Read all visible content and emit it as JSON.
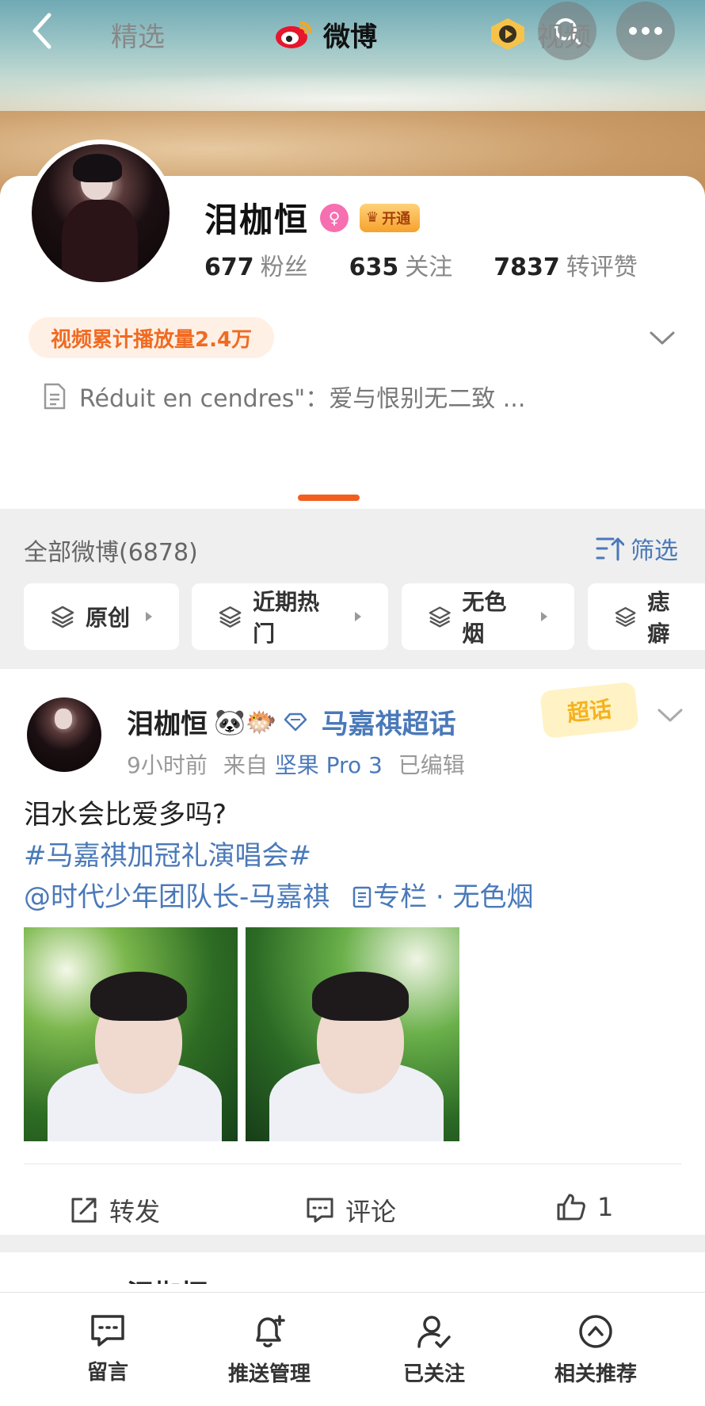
{
  "profile": {
    "name": "泪枷恒",
    "vip_badge": "开通",
    "gender_icon": "female-icon",
    "stats": [
      {
        "num": "677",
        "label": "粉丝"
      },
      {
        "num": "635",
        "label": "关注"
      },
      {
        "num": "7837",
        "label": "转评赞"
      }
    ],
    "play_count": "视频累计播放量2.4万",
    "bio": "Réduit en cendres\"：爱与恨别无二致 ..."
  },
  "tabs": [
    {
      "label": "精选"
    },
    {
      "label": "微博"
    },
    {
      "label": "视频"
    }
  ],
  "filter": {
    "header": "全部微博(6878)",
    "filter_label": "筛选",
    "chips": [
      "原创",
      "近期热门",
      "无色烟",
      "痣癖"
    ]
  },
  "post": {
    "author": "泪枷恒",
    "emojis": "🐼🐡",
    "topic": "马嘉祺超话",
    "chaohua_badge": "超话",
    "time": "9小时前",
    "from_label": "来自",
    "source": "坚果 Pro 3",
    "edited": "已编辑",
    "text_line1": "泪水会比爱多吗?",
    "hashtag": "#马嘉祺加冠礼演唱会#",
    "mention": "@时代少年团队长-马嘉祺",
    "column": "专栏 · 无色烟",
    "actions": {
      "repost": "转发",
      "comment": "评论",
      "like_count": "1"
    }
  },
  "next_post": {
    "author_partial": "泪枷恒"
  },
  "bottom_bar": [
    {
      "label": "留言",
      "icon": "message-icon"
    },
    {
      "label": "推送管理",
      "icon": "bell-plus-icon"
    },
    {
      "label": "已关注",
      "icon": "user-check-icon"
    },
    {
      "label": "相关推荐",
      "icon": "up-circle-icon"
    }
  ],
  "colors": {
    "accent_orange": "#f25e1f",
    "link_blue": "#4a79b9",
    "play_pill_bg": "#fff0e6"
  }
}
